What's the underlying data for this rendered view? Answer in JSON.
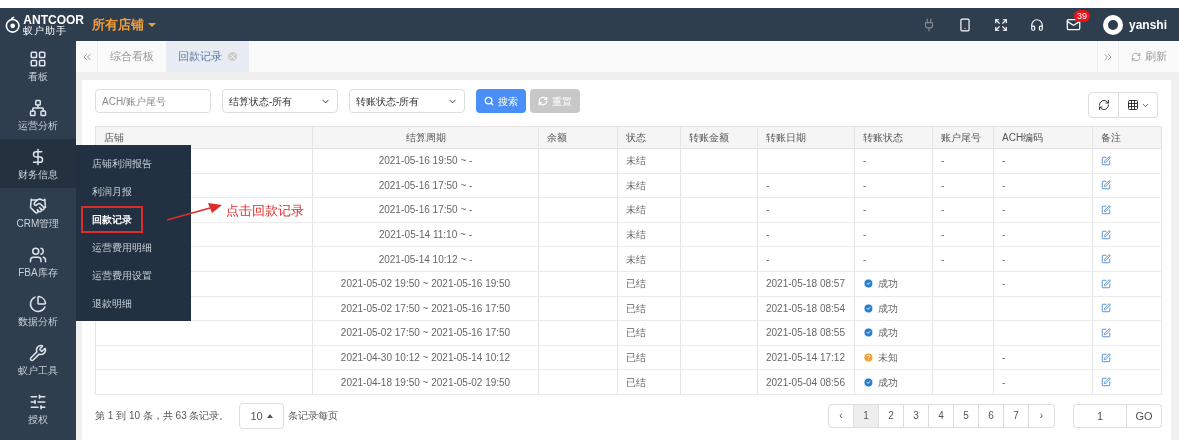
{
  "header": {
    "logo": "ANTCOOR",
    "logo_sub": "蚁户助手",
    "store_menu": "所有店铺",
    "mail_count": "39",
    "user": "yanshi"
  },
  "sidebar": {
    "items": [
      {
        "label": "看板",
        "selected": false
      },
      {
        "label": "运营分析",
        "selected": false
      },
      {
        "label": "财务信息",
        "selected": true
      },
      {
        "label": "CRM管理",
        "selected": false
      },
      {
        "label": "FBA库存",
        "selected": false
      },
      {
        "label": "数据分析",
        "selected": false
      },
      {
        "label": "蚁户工具",
        "selected": false
      },
      {
        "label": "授权",
        "selected": false
      }
    ]
  },
  "submenu": {
    "items": [
      {
        "label": "店铺利润报告",
        "selected": false
      },
      {
        "label": "利润月报",
        "selected": false
      },
      {
        "label": "回款记录",
        "selected": true
      },
      {
        "label": "运营费用明细",
        "selected": false
      },
      {
        "label": "运营费用设置",
        "selected": false
      },
      {
        "label": "退款明细",
        "selected": false
      }
    ]
  },
  "annotation": "点击回款记录",
  "tabs": [
    {
      "label": "综合看板",
      "selected": false
    },
    {
      "label": "回款记录",
      "selected": true
    }
  ],
  "refresh_label": "刷新",
  "filters": {
    "search": {
      "placeholder": "ACH/账户尾号"
    },
    "settle_status": "结算状态-所有",
    "transfer_status": "转账状态-所有",
    "search_button": "搜索",
    "reset_button": "重置"
  },
  "table": {
    "columns": [
      "店铺",
      "结算周期",
      "余额",
      "状态",
      "转账金额",
      "转账日期",
      "转账状态",
      "账户尾号",
      "ACH编码",
      "备注"
    ],
    "rows": [
      {
        "period": "2021-05-16 19:50 ~ -",
        "status": "未结",
        "transfer_status": {
          "kind": "none",
          "label": "-"
        },
        "account_tail": "-",
        "ach": "-"
      },
      {
        "period": "2021-05-16 17:50 ~ -",
        "status": "未结",
        "transfer_date": "-",
        "transfer_status": {
          "kind": "none",
          "label": "-"
        },
        "account_tail": "-",
        "ach": "-"
      },
      {
        "period": "2021-05-16 17:50 ~ -",
        "status": "未结",
        "transfer_date": "-",
        "transfer_status": {
          "kind": "none",
          "label": "-"
        },
        "account_tail": "-",
        "ach": "-"
      },
      {
        "period": "2021-05-14 11:10 ~ -",
        "status": "未结",
        "transfer_date": "-",
        "transfer_status": {
          "kind": "none",
          "label": "-"
        },
        "account_tail": "-",
        "ach": "-"
      },
      {
        "period": "2021-05-14 10:12 ~ -",
        "status": "未结",
        "transfer_date": "-",
        "transfer_status": {
          "kind": "none",
          "label": "-"
        },
        "account_tail": "-",
        "ach": "-"
      },
      {
        "period": "2021-05-02 19:50 ~ 2021-05-16 19:50",
        "status": "已结",
        "transfer_date": "2021-05-18 08:57",
        "transfer_status": {
          "kind": "success",
          "label": "成功"
        },
        "ach": "-"
      },
      {
        "period": "2021-05-02 17:50 ~ 2021-05-16 17:50",
        "status": "已结",
        "transfer_date": "2021-05-18 08:54",
        "transfer_status": {
          "kind": "success",
          "label": "成功"
        }
      },
      {
        "period": "2021-05-02 17:50 ~ 2021-05-16 17:50",
        "status": "已结",
        "transfer_date": "2021-05-18 08:55",
        "transfer_status": {
          "kind": "success",
          "label": "成功"
        }
      },
      {
        "period": "2021-04-30 10:12 ~ 2021-05-14 10:12",
        "status": "已结",
        "transfer_date": "2021-05-14 17:12",
        "transfer_status": {
          "kind": "unknown",
          "label": "未知"
        },
        "ach": "-"
      },
      {
        "period": "2021-04-18 19:50 ~ 2021-05-02 19:50",
        "status": "已结",
        "transfer_date": "2021-05-04 08:56",
        "transfer_status": {
          "kind": "success",
          "label": "成功"
        },
        "ach": "-"
      }
    ]
  },
  "pagination": {
    "summary": "第 1 到 10 条，共 63 条记录。",
    "page_size": "10",
    "page_size_label": "条记录每页",
    "prev": "‹",
    "next": "›",
    "pages": [
      {
        "label": "1",
        "selected": true
      },
      {
        "label": "2",
        "selected": false
      },
      {
        "label": "3",
        "selected": false
      },
      {
        "label": "4",
        "selected": false
      },
      {
        "label": "5",
        "selected": false
      },
      {
        "label": "6",
        "selected": false
      },
      {
        "label": "7",
        "selected": false
      }
    ],
    "go_value": "1",
    "go_button": "GO"
  }
}
